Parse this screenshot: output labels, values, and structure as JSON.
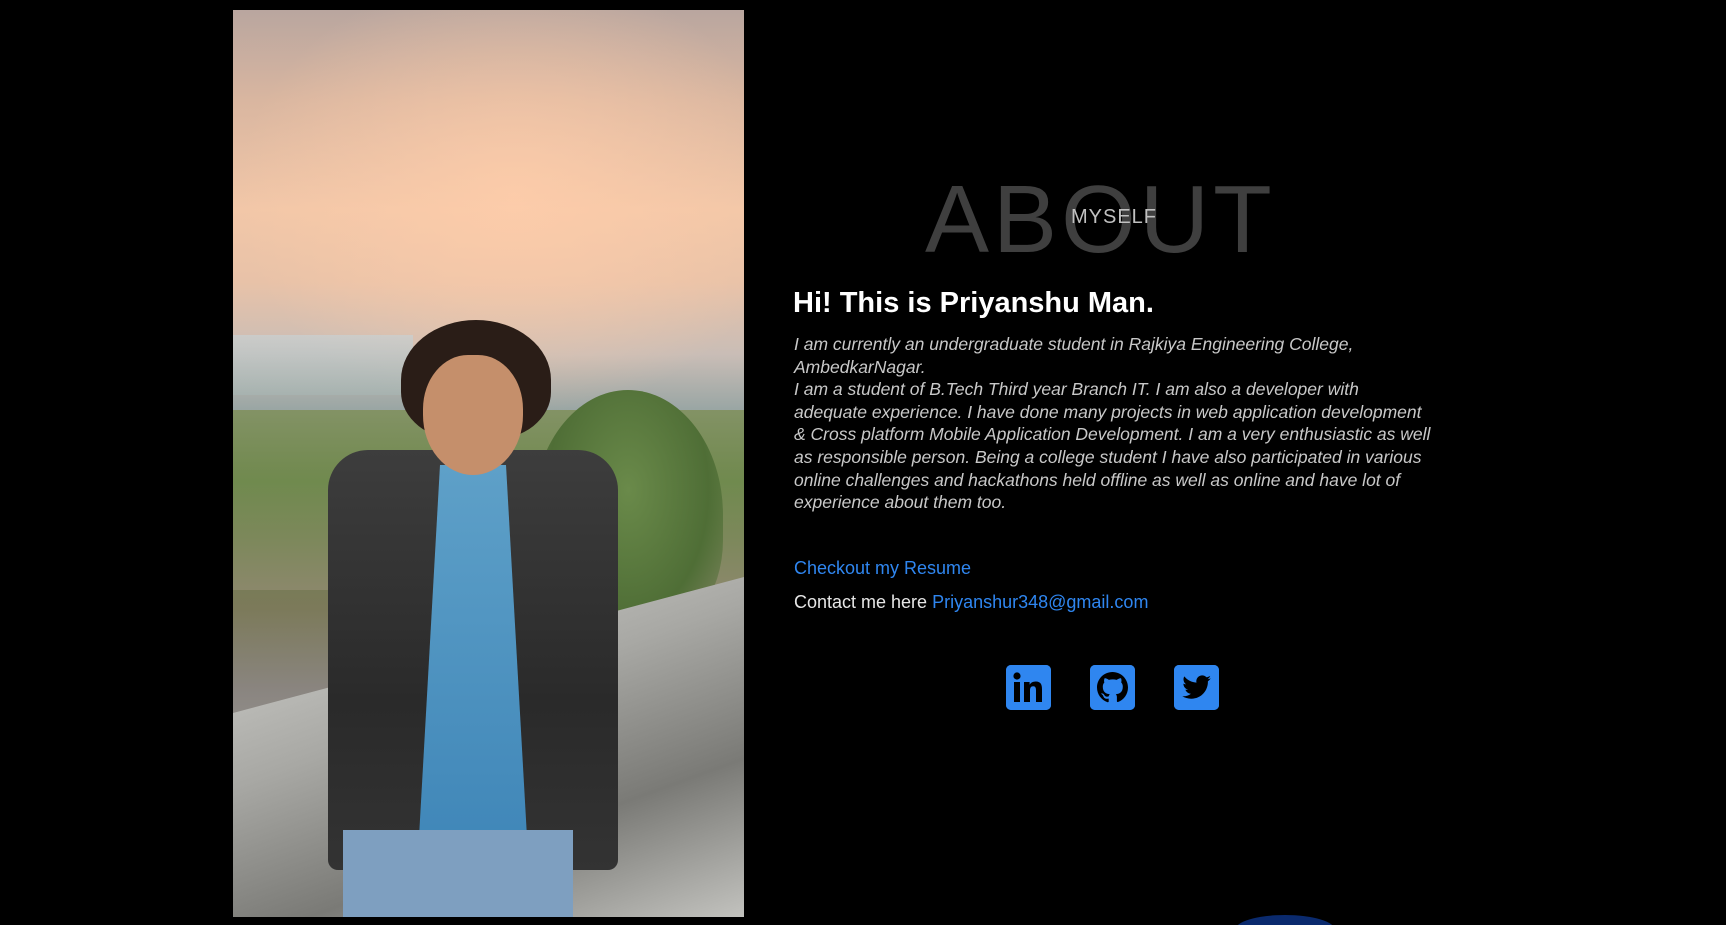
{
  "about": {
    "heading_big": "ABOUT",
    "heading_small": "MYSELF"
  },
  "intro": {
    "title": "Hi! This is Priyanshu Man.",
    "paragraph_1": "I am currently an undergraduate student in Rajkiya Engineering College, AmbedkarNagar.",
    "paragraph_2": "I am a student of B.Tech Third year Branch IT. I am also a developer with adequate experience. I have done many projects in web application development & Cross platform Mobile Application Development. I am a very enthusiastic as well as responsible person. Being a college student I have also participated in various online challenges and hackathons held offline as well as online and have lot of experience about them too."
  },
  "links": {
    "resume_label": "Checkout my Resume",
    "contact_prefix": "Contact me here ",
    "email": "Priyanshur348@gmail.com"
  },
  "socials": [
    {
      "name": "linkedin-icon"
    },
    {
      "name": "github-icon"
    },
    {
      "name": "twitter-icon"
    }
  ],
  "colors": {
    "background": "#000000",
    "accent": "#2f86f0",
    "heading_muted": "#3f3f3f",
    "body_text": "#c8c8c8"
  }
}
